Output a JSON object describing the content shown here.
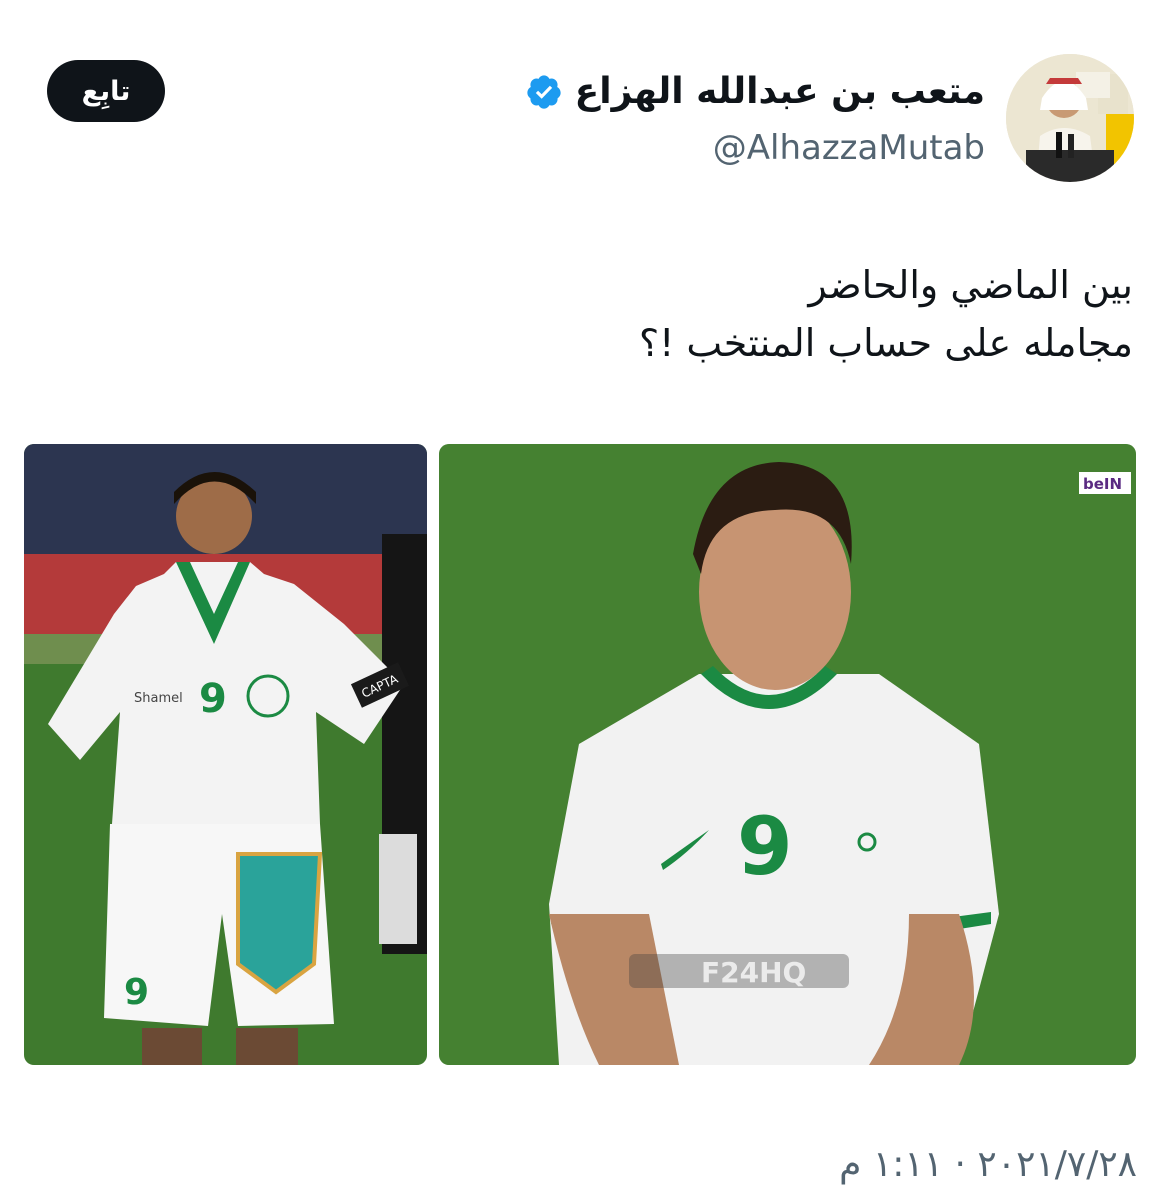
{
  "author": {
    "display_name": "متعب بن عبدالله الهزاع",
    "handle": "@AlhazzaMutab",
    "verified": true,
    "avatar_icon": "profile-photo"
  },
  "actions": {
    "follow_label": "تابِع"
  },
  "tweet": {
    "lines": [
      "بين الماضي والحاضر",
      "مجامله على حساب المنتخب !؟"
    ],
    "timestamp": "٢٠٢١/٧/٢٨ · ١:١١ م"
  },
  "media": {
    "left_photo": {
      "jersey_number": "9",
      "armband_text": "CAPTA",
      "sponsor_text": "Shamel"
    },
    "right_photo": {
      "jersey_number": "9",
      "broadcaster_logo": "beIN",
      "watermark": "F24HQ"
    }
  },
  "colors": {
    "verified": "#1d9bf0",
    "button_bg": "#0f1419",
    "secondary_text": "#536471",
    "kit_green": "#1b8a43",
    "pitch_green": "#3f7a2e"
  }
}
